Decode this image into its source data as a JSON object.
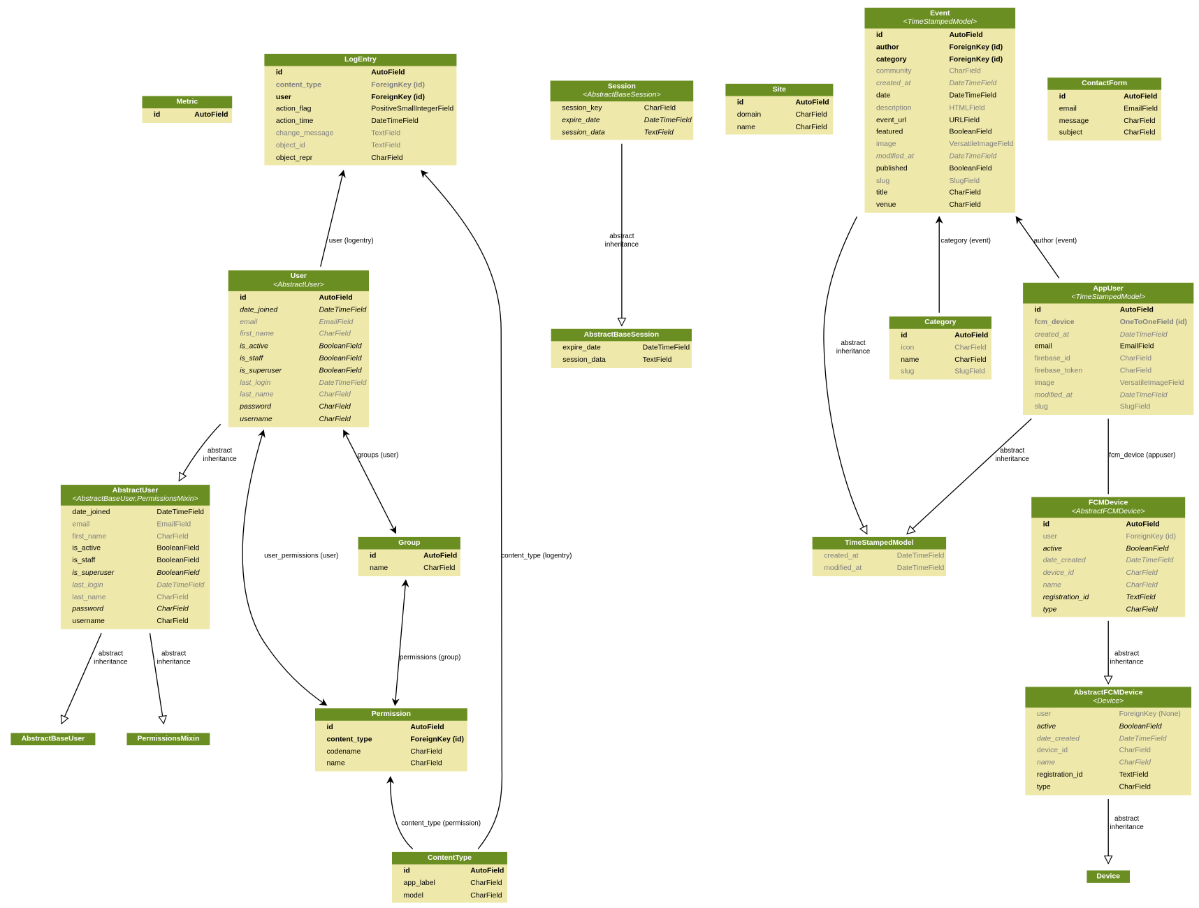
{
  "colors": {
    "header": "#6b8e23",
    "body": "#eee8aa",
    "muted": "#7f7f7f"
  },
  "models": [
    {
      "id": "metric",
      "name": "Metric",
      "fields": [
        [
          "id",
          "AutoField",
          "b"
        ]
      ]
    },
    {
      "id": "logentry",
      "name": "LogEntry",
      "fields": [
        [
          "id",
          "AutoField",
          "b"
        ],
        [
          "content_type",
          "ForeignKey (id)",
          "b g"
        ],
        [
          "user",
          "ForeignKey (id)",
          "b"
        ],
        [
          "action_flag",
          "PositiveSmallIntegerField",
          ""
        ],
        [
          "action_time",
          "DateTimeField",
          ""
        ],
        [
          "change_message",
          "TextField",
          "g"
        ],
        [
          "object_id",
          "TextField",
          "g"
        ],
        [
          "object_repr",
          "CharField",
          ""
        ]
      ]
    },
    {
      "id": "session",
      "name": "Session",
      "parent": "<AbstractBaseSession>",
      "fields": [
        [
          "session_key",
          "CharField",
          ""
        ],
        [
          "expire_date",
          "DateTimeField",
          "i"
        ],
        [
          "session_data",
          "TextField",
          "i"
        ]
      ]
    },
    {
      "id": "site",
      "name": "Site",
      "fields": [
        [
          "id",
          "AutoField",
          "b"
        ],
        [
          "domain",
          "CharField",
          ""
        ],
        [
          "name",
          "CharField",
          ""
        ]
      ]
    },
    {
      "id": "event",
      "name": "Event",
      "parent": "<TimeStampedModel>",
      "fields": [
        [
          "id",
          "AutoField",
          "b"
        ],
        [
          "author",
          "ForeignKey (id)",
          "b"
        ],
        [
          "category",
          "ForeignKey (id)",
          "b"
        ],
        [
          "community",
          "CharField",
          "g"
        ],
        [
          "created_at",
          "DateTimeField",
          "g i"
        ],
        [
          "date",
          "DateTimeField",
          ""
        ],
        [
          "description",
          "HTMLField",
          "g"
        ],
        [
          "event_url",
          "URLField",
          ""
        ],
        [
          "featured",
          "BooleanField",
          ""
        ],
        [
          "image",
          "VersatileImageField",
          "g"
        ],
        [
          "modified_at",
          "DateTimeField",
          "g i"
        ],
        [
          "published",
          "BooleanField",
          ""
        ],
        [
          "slug",
          "SlugField",
          "g"
        ],
        [
          "title",
          "CharField",
          ""
        ],
        [
          "venue",
          "CharField",
          ""
        ]
      ]
    },
    {
      "id": "contactform",
      "name": "ContactForm",
      "fields": [
        [
          "id",
          "AutoField",
          "b"
        ],
        [
          "email",
          "EmailField",
          ""
        ],
        [
          "message",
          "CharField",
          ""
        ],
        [
          "subject",
          "CharField",
          ""
        ]
      ]
    },
    {
      "id": "user",
      "name": "User",
      "parent": "<AbstractUser>",
      "fields": [
        [
          "id",
          "AutoField",
          "b"
        ],
        [
          "date_joined",
          "DateTimeField",
          "i"
        ],
        [
          "email",
          "EmailField",
          "g i"
        ],
        [
          "first_name",
          "CharField",
          "g i"
        ],
        [
          "is_active",
          "BooleanField",
          "i"
        ],
        [
          "is_staff",
          "BooleanField",
          "i"
        ],
        [
          "is_superuser",
          "BooleanField",
          "i"
        ],
        [
          "last_login",
          "DateTimeField",
          "g i"
        ],
        [
          "last_name",
          "CharField",
          "g i"
        ],
        [
          "password",
          "CharField",
          "i"
        ],
        [
          "username",
          "CharField",
          "i"
        ]
      ]
    },
    {
      "id": "abstractbasesession",
      "name": "AbstractBaseSession",
      "fields": [
        [
          "expire_date",
          "DateTimeField",
          ""
        ],
        [
          "session_data",
          "TextField",
          ""
        ]
      ]
    },
    {
      "id": "category",
      "name": "Category",
      "fields": [
        [
          "id",
          "AutoField",
          "b"
        ],
        [
          "icon",
          "CharField",
          "g"
        ],
        [
          "name",
          "CharField",
          ""
        ],
        [
          "slug",
          "SlugField",
          "g"
        ]
      ]
    },
    {
      "id": "appuser",
      "name": "AppUser",
      "parent": "<TimeStampedModel>",
      "fields": [
        [
          "id",
          "AutoField",
          "b"
        ],
        [
          "fcm_device",
          "OneToOneField (id)",
          "b g"
        ],
        [
          "created_at",
          "DateTimeField",
          "g i"
        ],
        [
          "email",
          "EmailField",
          ""
        ],
        [
          "firebase_id",
          "CharField",
          "g"
        ],
        [
          "firebase_token",
          "CharField",
          "g"
        ],
        [
          "image",
          "VersatileImageField",
          "g"
        ],
        [
          "modified_at",
          "DateTimeField",
          "g i"
        ],
        [
          "slug",
          "SlugField",
          "g"
        ]
      ]
    },
    {
      "id": "abstractuser",
      "name": "AbstractUser",
      "parent": "<AbstractBaseUser,PermissionsMixin>",
      "fields": [
        [
          "date_joined",
          "DateTimeField",
          ""
        ],
        [
          "email",
          "EmailField",
          "g"
        ],
        [
          "first_name",
          "CharField",
          "g"
        ],
        [
          "is_active",
          "BooleanField",
          ""
        ],
        [
          "is_staff",
          "BooleanField",
          ""
        ],
        [
          "is_superuser",
          "BooleanField",
          "i"
        ],
        [
          "last_login",
          "DateTimeField",
          "g i"
        ],
        [
          "last_name",
          "CharField",
          "g"
        ],
        [
          "password",
          "CharField",
          "i"
        ],
        [
          "username",
          "CharField",
          ""
        ]
      ]
    },
    {
      "id": "group",
      "name": "Group",
      "fields": [
        [
          "id",
          "AutoField",
          "b"
        ],
        [
          "name",
          "CharField",
          ""
        ]
      ]
    },
    {
      "id": "timestampedmodel",
      "name": "TimeStampedModel",
      "fields": [
        [
          "created_at",
          "DateTimeField",
          "g"
        ],
        [
          "modified_at",
          "DateTimeField",
          "g"
        ]
      ]
    },
    {
      "id": "fcmdevice",
      "name": "FCMDevice",
      "parent": "<AbstractFCMDevice>",
      "fields": [
        [
          "id",
          "AutoField",
          "b"
        ],
        [
          "user",
          "ForeignKey (id)",
          "g"
        ],
        [
          "active",
          "BooleanField",
          "i"
        ],
        [
          "date_created",
          "DateTimeField",
          "g i"
        ],
        [
          "device_id",
          "CharField",
          "g i"
        ],
        [
          "name",
          "CharField",
          "g i"
        ],
        [
          "registration_id",
          "TextField",
          "i"
        ],
        [
          "type",
          "CharField",
          "i"
        ]
      ]
    },
    {
      "id": "permission",
      "name": "Permission",
      "fields": [
        [
          "id",
          "AutoField",
          "b"
        ],
        [
          "content_type",
          "ForeignKey (id)",
          "b"
        ],
        [
          "codename",
          "CharField",
          ""
        ],
        [
          "name",
          "CharField",
          ""
        ]
      ]
    },
    {
      "id": "abstractbaseuser",
      "name": "AbstractBaseUser",
      "fields": []
    },
    {
      "id": "permissionsmixin",
      "name": "PermissionsMixin",
      "fields": []
    },
    {
      "id": "abstractfcmdevice",
      "name": "AbstractFCMDevice",
      "parent": "<Device>",
      "fields": [
        [
          "user",
          "ForeignKey (None)",
          "g"
        ],
        [
          "active",
          "BooleanField",
          "i"
        ],
        [
          "date_created",
          "DateTimeField",
          "g i"
        ],
        [
          "device_id",
          "CharField",
          "g"
        ],
        [
          "name",
          "CharField",
          "g i"
        ],
        [
          "registration_id",
          "TextField",
          ""
        ],
        [
          "type",
          "CharField",
          ""
        ]
      ]
    },
    {
      "id": "contenttype",
      "name": "ContentType",
      "fields": [
        [
          "id",
          "AutoField",
          "b"
        ],
        [
          "app_label",
          "CharField",
          ""
        ],
        [
          "model",
          "CharField",
          ""
        ]
      ]
    },
    {
      "id": "device",
      "name": "Device",
      "fields": []
    }
  ],
  "edges": [
    {
      "id": "user-logentry",
      "label": "user (logentry)",
      "kind": "relation"
    },
    {
      "id": "contenttype-logentry",
      "label": "content_type (logentry)",
      "kind": "relation"
    },
    {
      "id": "session-abstractbasesession",
      "label": "abstract\ninheritance",
      "kind": "inheritance"
    },
    {
      "id": "event-timestampedmodel",
      "label": "abstract\ninheritance",
      "kind": "inheritance"
    },
    {
      "id": "category-event",
      "label": "category (event)",
      "kind": "relation"
    },
    {
      "id": "author-event",
      "label": "author (event)",
      "kind": "relation"
    },
    {
      "id": "appuser-timestampedmodel",
      "label": "abstract\ninheritance",
      "kind": "inheritance"
    },
    {
      "id": "fcmdevice-appuser",
      "label": "fcm_device (appuser)",
      "kind": "one-to-one"
    },
    {
      "id": "fcmdevice-abstractfcmdevice",
      "label": "abstract\ninheritance",
      "kind": "inheritance"
    },
    {
      "id": "abstractfcmdevice-device",
      "label": "abstract\ninheritance",
      "kind": "inheritance"
    },
    {
      "id": "user-abstractuser",
      "label": "abstract\ninheritance",
      "kind": "inheritance"
    },
    {
      "id": "groups-user",
      "label": "groups (user)",
      "kind": "many-to-many"
    },
    {
      "id": "userpermissions-user",
      "label": "user_permissions (user)",
      "kind": "many-to-many"
    },
    {
      "id": "abstractuser-abstractbaseuser",
      "label": "abstract\ninheritance",
      "kind": "inheritance"
    },
    {
      "id": "abstractuser-permissionsmixin",
      "label": "abstract\ninheritance",
      "kind": "inheritance"
    },
    {
      "id": "permissions-group",
      "label": "permissions (group)",
      "kind": "many-to-many"
    },
    {
      "id": "contenttype-permission",
      "label": "content_type (permission)",
      "kind": "relation"
    }
  ]
}
